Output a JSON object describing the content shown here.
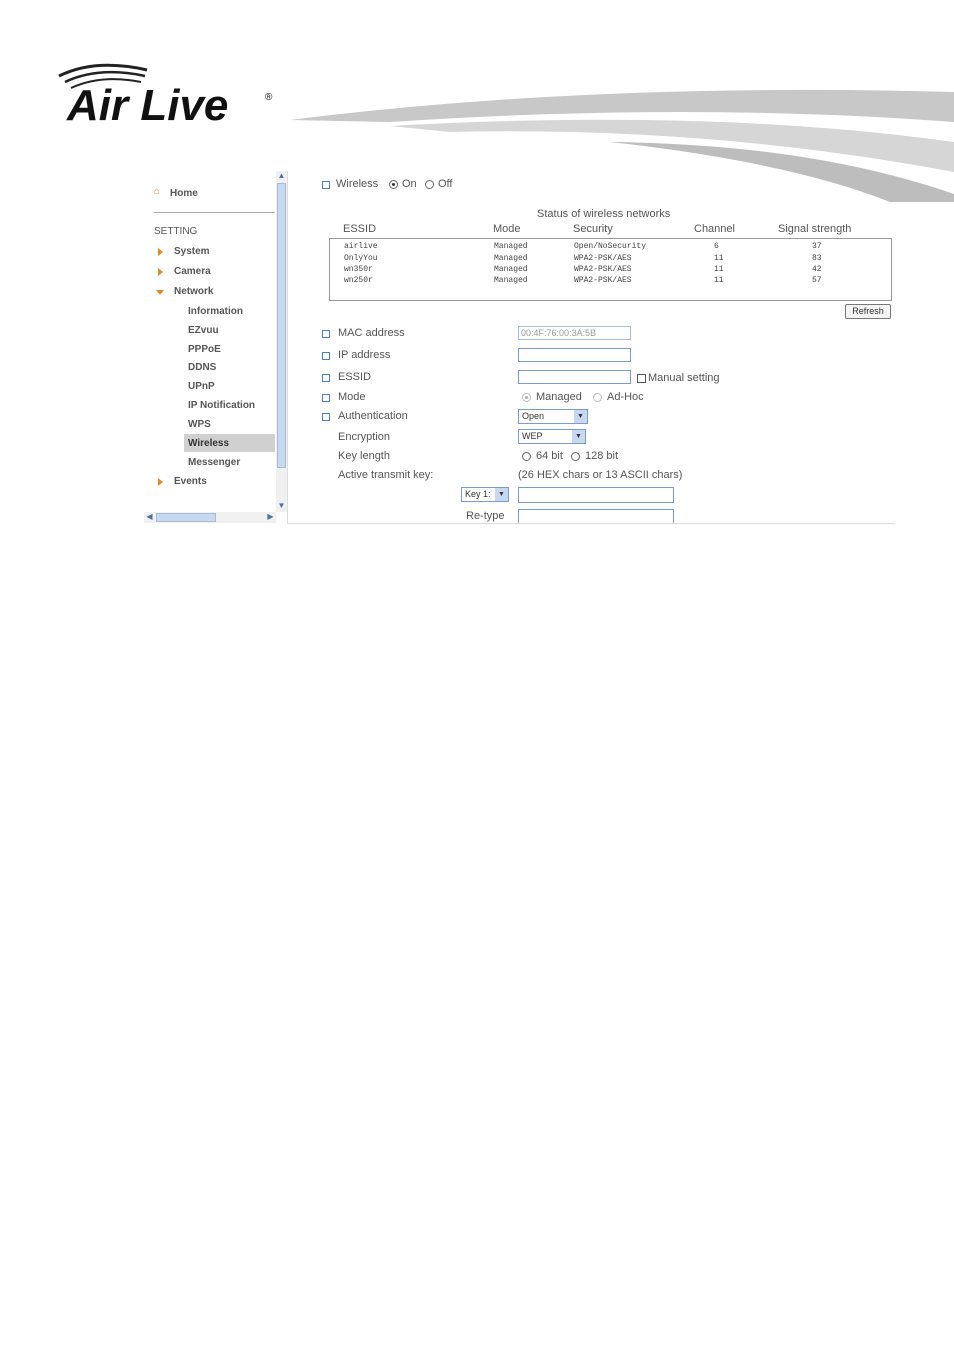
{
  "brand": {
    "logo_text": "Air Live",
    "registered": "®"
  },
  "sidebar": {
    "home": "Home",
    "section": "SETTING",
    "items": [
      {
        "label": "System"
      },
      {
        "label": "Camera"
      },
      {
        "label": "Network"
      },
      {
        "label": "Events"
      }
    ],
    "network_sub": [
      {
        "label": "Information"
      },
      {
        "label": "EZvuu"
      },
      {
        "label": "PPPoE"
      },
      {
        "label": "DDNS"
      },
      {
        "label": "UPnP"
      },
      {
        "label": "IP Notification"
      },
      {
        "label": "WPS"
      },
      {
        "label": "Wireless",
        "active": true
      },
      {
        "label": "Messenger"
      }
    ]
  },
  "wireless": {
    "label": "Wireless",
    "on_label": "On",
    "off_label": "Off",
    "selected": "On"
  },
  "networks": {
    "title": "Status of wireless networks",
    "columns": [
      "ESSID",
      "Mode",
      "Security",
      "Channel",
      "Signal strength"
    ],
    "rows": [
      {
        "essid": "airlive",
        "mode": "Managed",
        "security": "Open/NoSecurity",
        "channel": "6",
        "signal": "37"
      },
      {
        "essid": "OnlyYou",
        "mode": "Managed",
        "security": "WPA2-PSK/AES",
        "channel": "11",
        "signal": "83"
      },
      {
        "essid": "wn350r",
        "mode": "Managed",
        "security": "WPA2-PSK/AES",
        "channel": "11",
        "signal": "42"
      },
      {
        "essid": "wn250r",
        "mode": "Managed",
        "security": "WPA2-PSK/AES",
        "channel": "11",
        "signal": "57"
      }
    ],
    "refresh": "Refresh"
  },
  "form": {
    "mac_label": "MAC address",
    "mac_value": "00:4F:76:00:3A:5B",
    "ip_label": "IP address",
    "ip_value": "",
    "essid_label": "ESSID",
    "essid_value": "",
    "manual_label": "Manual setting",
    "mode_label": "Mode",
    "mode_managed": "Managed",
    "mode_adhoc": "Ad-Hoc",
    "auth_label": "Authentication",
    "auth_value": "Open",
    "enc_label": "Encryption",
    "enc_value": "WEP",
    "keylen_label": "Key length",
    "keylen_64": "64 bit",
    "keylen_128": "128 bit",
    "active_key_label": "Active transmit key:",
    "key_hint": "(26 HEX chars or 13 ASCII chars)",
    "key_select": "Key 1:",
    "retype_label": "Re-type"
  },
  "colors": {
    "accent_arrow": "#e08a2a",
    "bullet": "#4a7fc0",
    "active_item": "#d0d0d0"
  }
}
